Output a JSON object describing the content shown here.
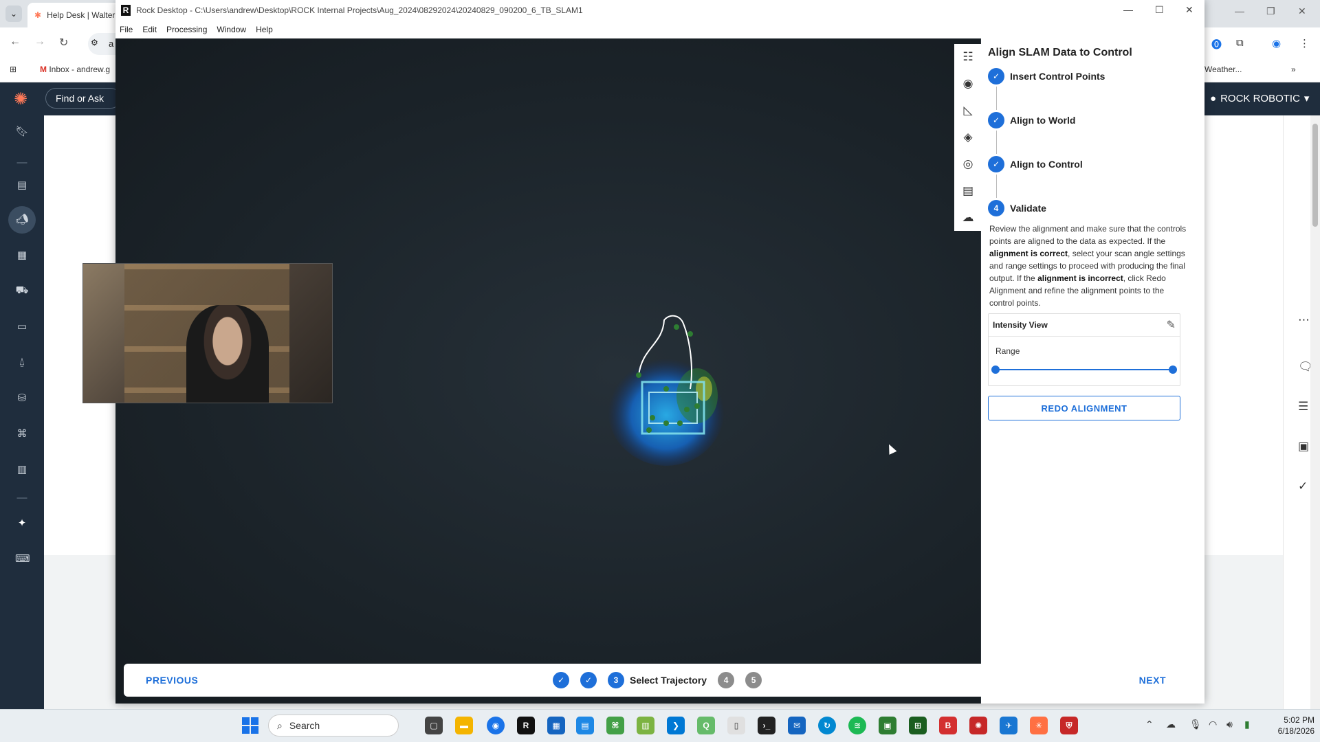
{
  "browser": {
    "tab_title": "Help Desk | Walter",
    "omnibox_text": "a",
    "bookmarks": [
      "Inbox - andrew.g",
      "Weather..."
    ],
    "find_ask": "Find or Ask",
    "account_name": "ROCK ROBOTIC"
  },
  "rock_desktop": {
    "window_title": "Rock Desktop - C:\\Users\\andrew\\Desktop\\ROCK Internal Projects\\Aug_2024\\08292024\\20240829_090200_6_TB_SLAM1",
    "menu": [
      "File",
      "Edit",
      "Processing",
      "Window",
      "Help"
    ],
    "tools": [
      "sliders-icon",
      "target-icon",
      "ruler-icon",
      "layers-icon",
      "eye-icon",
      "document-icon",
      "cloud-upload-icon"
    ],
    "panel": {
      "title": "Align SLAM Data to Control",
      "steps": [
        {
          "label": "Insert Control Points",
          "status": "done"
        },
        {
          "label": "Align to World",
          "status": "done"
        },
        {
          "label": "Align to Control",
          "status": "done"
        },
        {
          "label": "Validate",
          "status": "active",
          "number": "4"
        }
      ],
      "description_parts": [
        "Review the alignment and make sure that the controls points are aligned to the data as expected. If the ",
        "alignment is correct",
        ", select your scan angle settings and range settings to proceed with producing the final output. If the ",
        "alignment is incorrect",
        ", click Redo Alignment and refine the alignment points to the control points."
      ],
      "intensity_view": "Intensity View",
      "range_label": "Range",
      "range_value": [
        0.0,
        1.0
      ],
      "redo_button": "REDO ALIGNMENT"
    },
    "bottom_nav": {
      "previous": "PREVIOUS",
      "next": "NEXT",
      "steps": [
        {
          "status": "done"
        },
        {
          "status": "done"
        },
        {
          "status": "active",
          "number": "3",
          "label": "Select Trajectory"
        },
        {
          "status": "pending",
          "number": "4"
        },
        {
          "status": "pending",
          "number": "5"
        }
      ]
    }
  },
  "taskbar": {
    "search_label": "Search",
    "time": "5:02 PM",
    "date": "6/18/2026"
  },
  "colors": {
    "accent": "#1e6fd9",
    "viewport_bg": "#1b2329",
    "hubspot_nav": "#1f2d3d",
    "hubspot_logo": "#ff7a59"
  }
}
